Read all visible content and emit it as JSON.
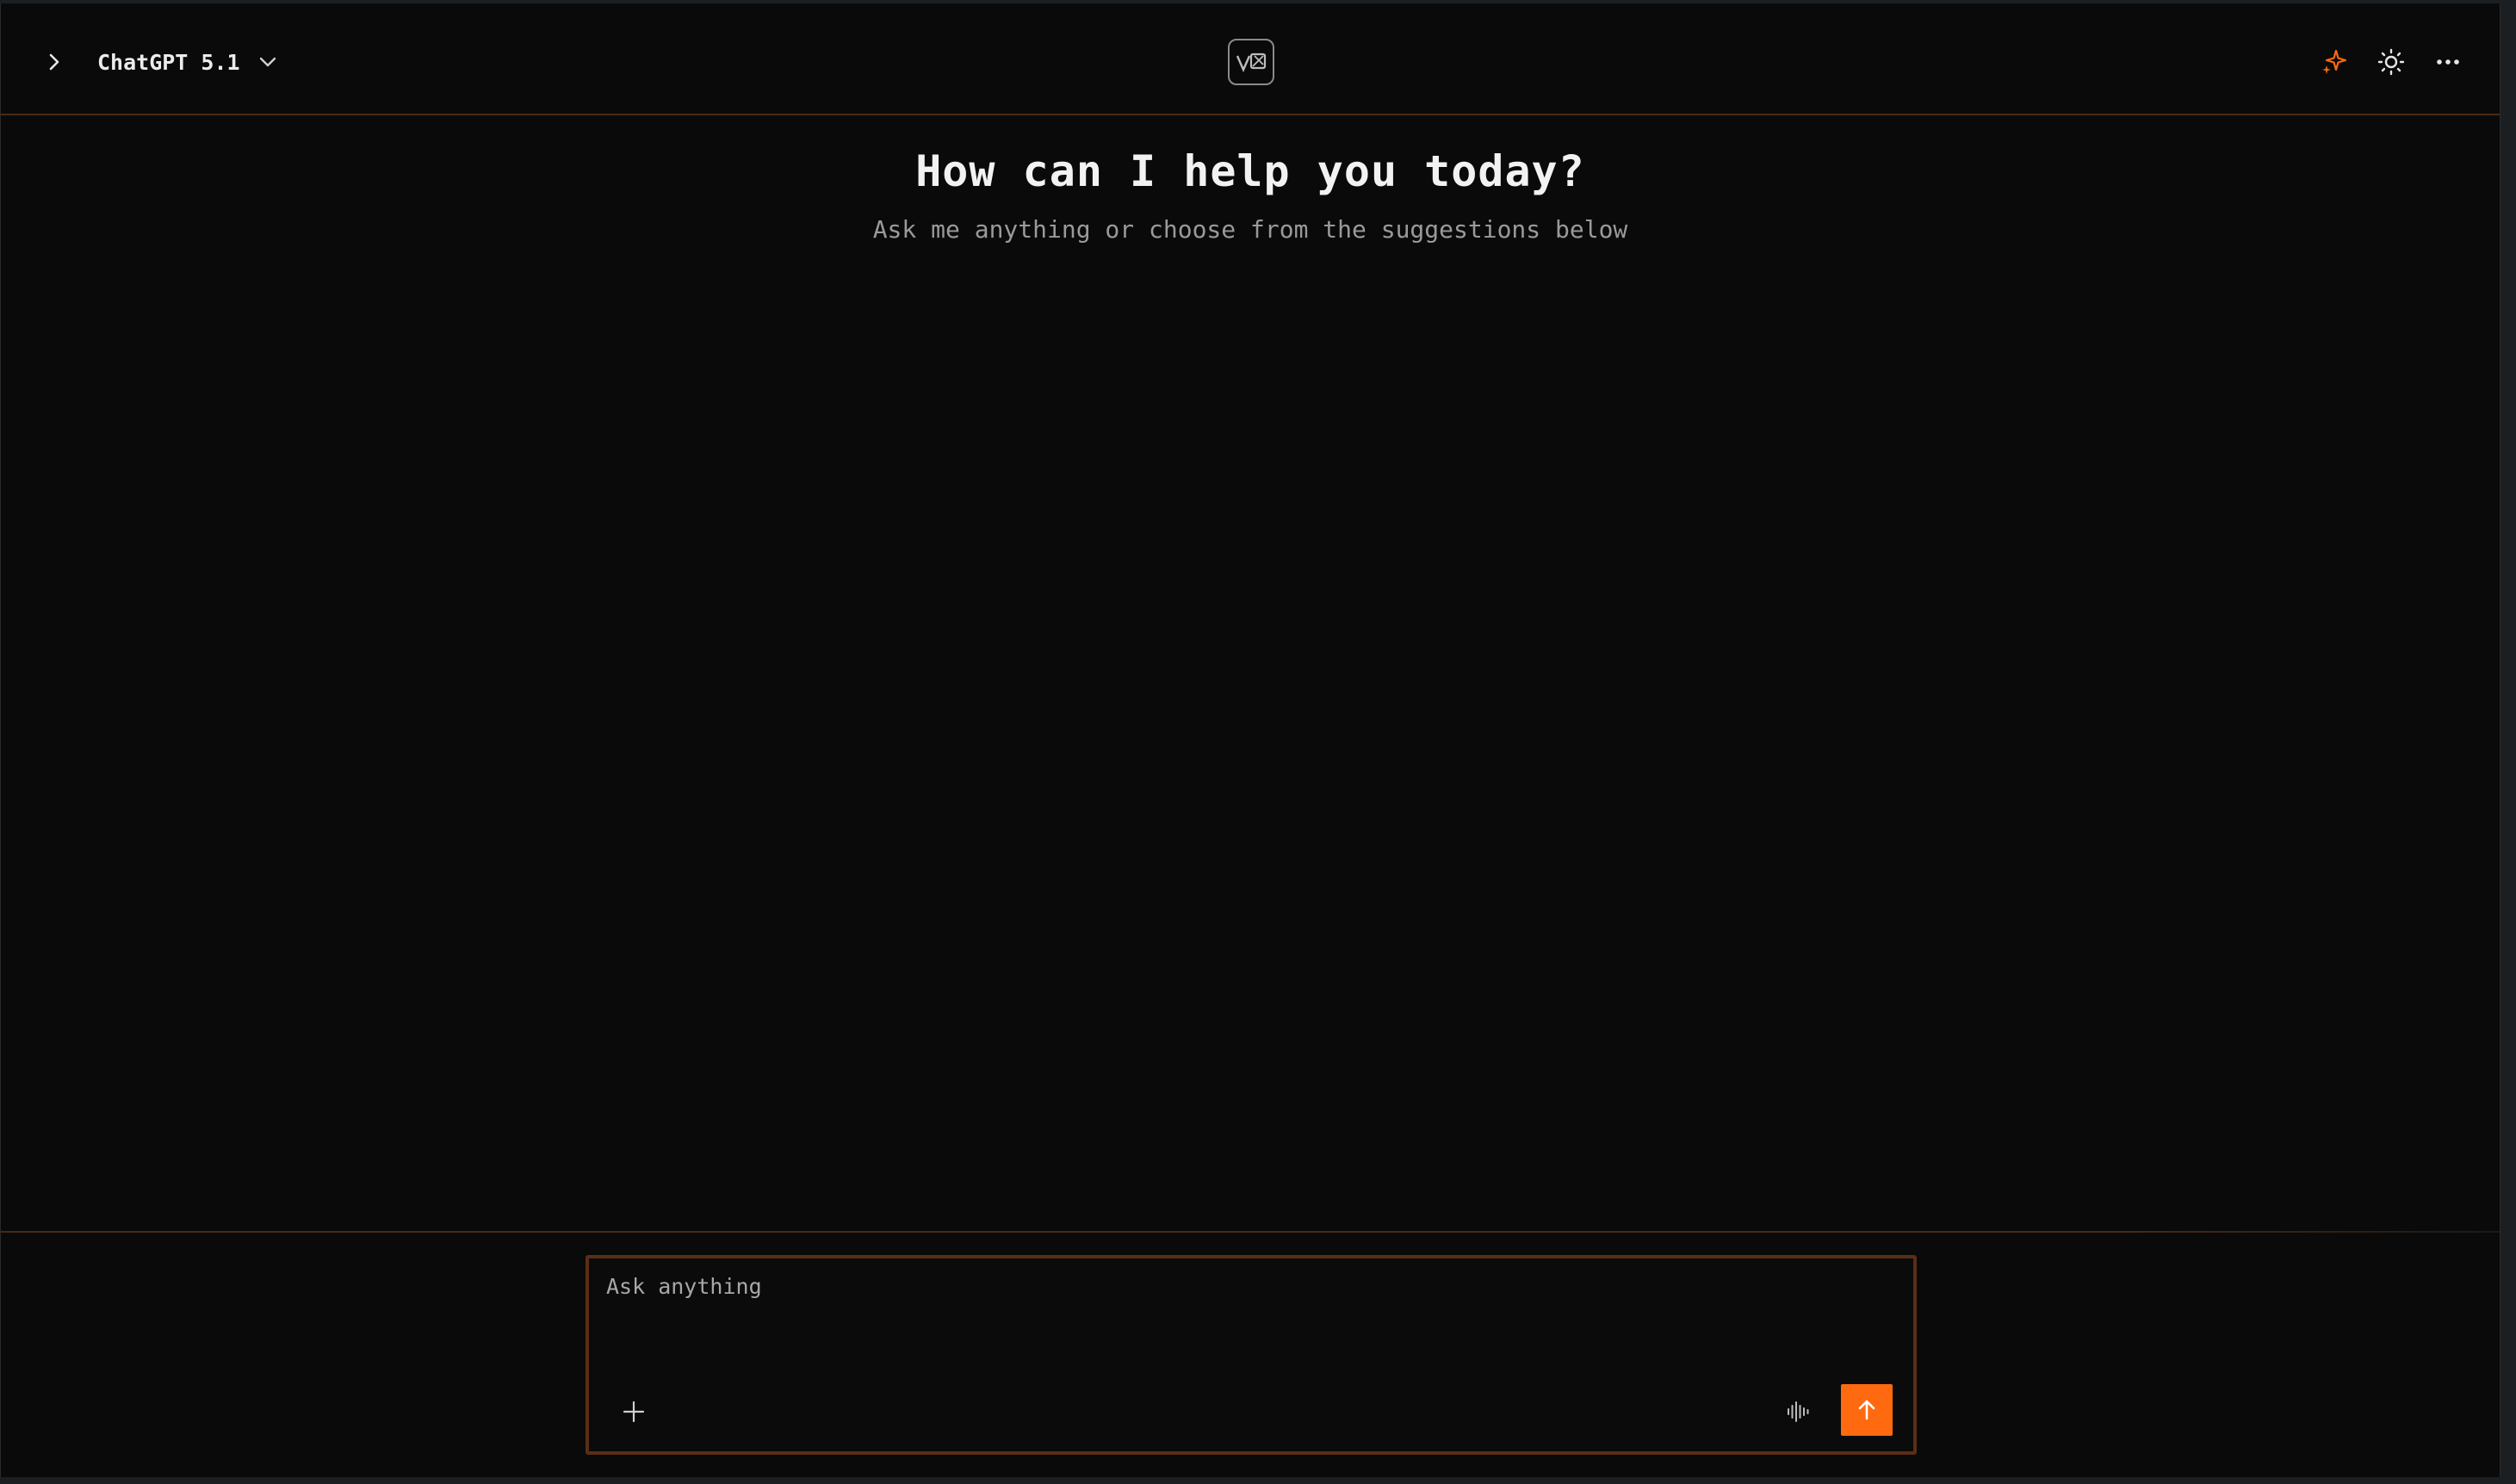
{
  "header": {
    "model_name": "ChatGPT 5.1",
    "icons": {
      "sidebar_toggle": "chevron-right-icon",
      "model_dropdown": "chevron-down-icon",
      "logo": "app-logo",
      "sparkle": "sparkle-icon",
      "theme": "sun-icon",
      "more": "more-horizontal-icon"
    }
  },
  "main": {
    "title": "How can I help you today?",
    "subtitle": "Ask me anything or choose from the suggestions below"
  },
  "composer": {
    "placeholder": "Ask anything",
    "value": "",
    "icons": {
      "attach": "plus-icon",
      "voice": "waveform-icon",
      "send": "arrow-up-icon"
    }
  },
  "colors": {
    "accent": "#ff6a10",
    "background": "#0a0a0a",
    "border": "#5a2e14"
  }
}
